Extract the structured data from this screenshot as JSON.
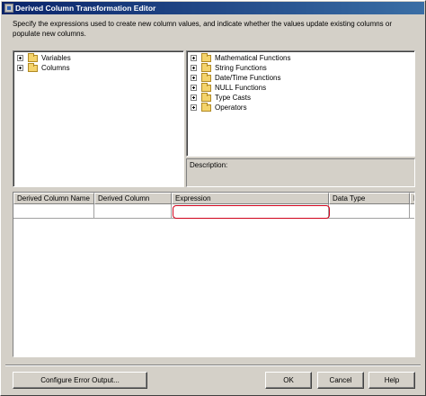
{
  "window": {
    "title": "Derived Column Transformation Editor"
  },
  "instructions": "Specify the expressions used to create new column values, and indicate whether the values update existing columns or populate new columns.",
  "left_tree": {
    "items": [
      {
        "label": "Variables",
        "icon": "folder-icon"
      },
      {
        "label": "Columns",
        "icon": "folder-icon"
      }
    ]
  },
  "right_tree": {
    "items": [
      {
        "label": "Mathematical Functions",
        "icon": "folder-icon"
      },
      {
        "label": "String Functions",
        "icon": "folder-icon"
      },
      {
        "label": "Date/Time Functions",
        "icon": "folder-icon"
      },
      {
        "label": "NULL Functions",
        "icon": "folder-icon"
      },
      {
        "label": "Type Casts",
        "icon": "folder-icon"
      },
      {
        "label": "Operators",
        "icon": "folder-icon"
      }
    ]
  },
  "description_panel": {
    "label": "Description:"
  },
  "grid": {
    "columns": [
      "Derived Column Name",
      "Derived Column",
      "Expression",
      "Data Type",
      "Le"
    ],
    "highlight_color": "#d0021b"
  },
  "buttons": {
    "configure_error_output": "Configure Error Output...",
    "ok": "OK",
    "cancel": "Cancel",
    "help": "Help"
  }
}
